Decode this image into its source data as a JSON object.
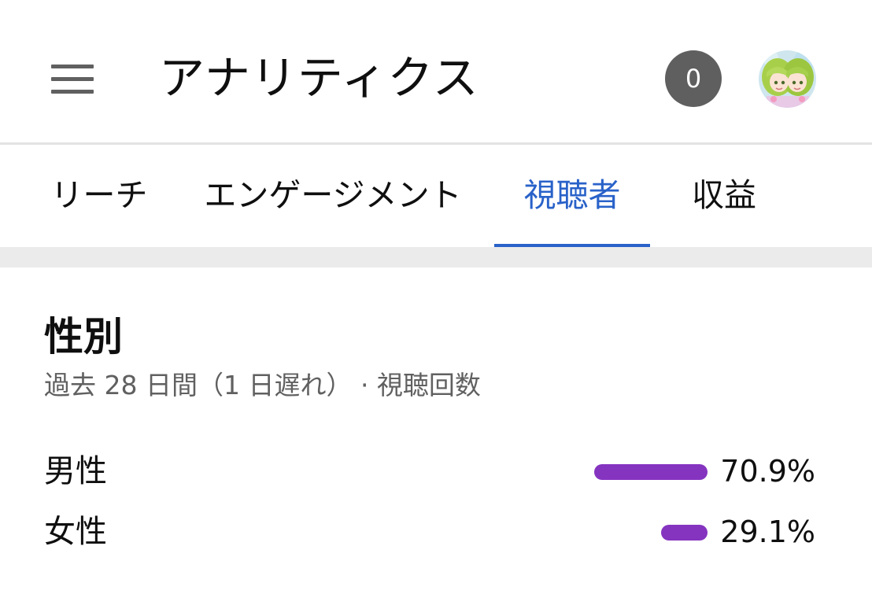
{
  "header": {
    "title": "アナリティクス",
    "notification_count": "0",
    "menu_icon": "hamburger-menu-icon",
    "avatar_icon": "avatar"
  },
  "tabs": [
    {
      "label": "リーチ",
      "active": false
    },
    {
      "label": "エンゲージメント",
      "active": false
    },
    {
      "label": "視聴者",
      "active": true
    },
    {
      "label": "収益",
      "active": false
    }
  ],
  "colors": {
    "accent": "#2962c9",
    "bar": "#8534c0",
    "badge": "#5f5f5f"
  },
  "gender_card": {
    "title": "性別",
    "subtitle": "過去 28 日間（1 日遅れ） · 視聴回数",
    "rows": [
      {
        "label": "男性",
        "value_text": "70.9%",
        "percent": 70.9
      },
      {
        "label": "女性",
        "value_text": "29.1%",
        "percent": 29.1
      }
    ]
  }
}
